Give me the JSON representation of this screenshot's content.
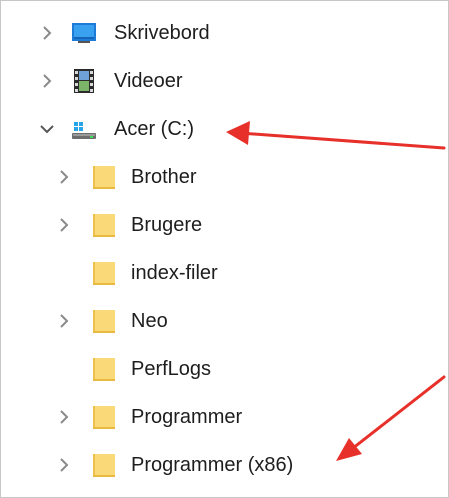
{
  "tree": {
    "items": [
      {
        "label": "Skrivebord",
        "icon": "desktop-icon",
        "expander": "collapsed"
      },
      {
        "label": "Videoer",
        "icon": "video-folder-icon",
        "expander": "collapsed"
      },
      {
        "label": "Acer (C:)",
        "icon": "drive-icon",
        "expander": "expanded"
      },
      {
        "label": "Brother",
        "icon": "folder-icon",
        "expander": "collapsed"
      },
      {
        "label": "Brugere",
        "icon": "folder-icon",
        "expander": "collapsed"
      },
      {
        "label": "index-filer",
        "icon": "folder-icon",
        "expander": "none"
      },
      {
        "label": "Neo",
        "icon": "folder-icon",
        "expander": "collapsed"
      },
      {
        "label": "PerfLogs",
        "icon": "folder-icon",
        "expander": "none"
      },
      {
        "label": "Programmer",
        "icon": "folder-icon",
        "expander": "collapsed"
      },
      {
        "label": "Programmer (x86)",
        "icon": "folder-icon",
        "expander": "collapsed"
      }
    ]
  },
  "annotations": {
    "arrow_color": "#e8302a"
  },
  "colors": {
    "folder": "#f9d978",
    "chevron": "#8a8a8a",
    "text": "#1e1e1e"
  }
}
